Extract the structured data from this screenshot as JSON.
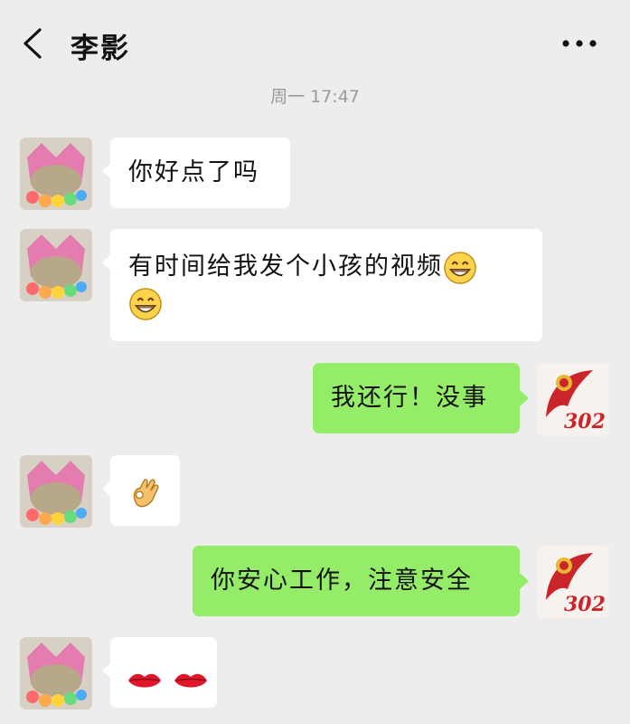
{
  "header": {
    "contact_name": "李影",
    "back_icon": "chevron-left-icon",
    "more_icon": "more-dots-icon"
  },
  "timestamp": "周一 17:47",
  "colors": {
    "background": "#ededed",
    "incoming_bubble": "#ffffff",
    "outgoing_bubble": "#95ec69"
  },
  "messages": [
    {
      "direction": "incoming",
      "text": "你好点了吗"
    },
    {
      "direction": "incoming",
      "text": "有时间给我发个小孩的视频",
      "emojis": [
        "grinning-face-icon",
        "grinning-face-icon"
      ]
    },
    {
      "direction": "outgoing",
      "text": "我还行！没事"
    },
    {
      "direction": "incoming",
      "text": "",
      "emojis": [
        "ok-hand-icon"
      ]
    },
    {
      "direction": "outgoing",
      "text": "你安心工作，注意安全"
    },
    {
      "direction": "incoming",
      "text": "",
      "emojis": [
        "lips-icon",
        "lips-icon"
      ]
    }
  ]
}
